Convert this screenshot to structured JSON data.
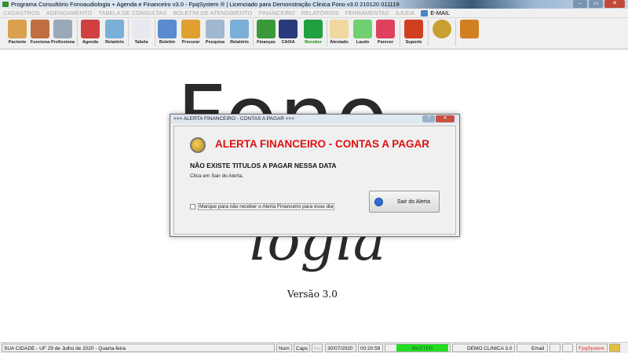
{
  "window": {
    "title": "Programa Consultório Fonoaudiologia + Agenda e Financeiro v3.0 - FpqSystem ® | Licenciado para  Demonstração Clinica Fono v3.0 210120 011119",
    "min": "–",
    "max": "▭",
    "close": "✕"
  },
  "menu": [
    "CADASTROS",
    "AGENDAMENTO",
    "TABELA DE CONSULTAS",
    "BOLETIM DE ATENDIMENTO",
    "FINANCEIRO",
    "RELATÓRIOS",
    "FERRAMENTAS",
    "AJUDA"
  ],
  "menu_email": "E-MAIL",
  "toolbar": [
    {
      "label": "Paciente",
      "icon": "patients-icon",
      "color": "#d9a050"
    },
    {
      "label": "Funciona",
      "icon": "employees-icon",
      "color": "#c07040"
    },
    {
      "label": "Profissiona",
      "icon": "doctor-icon",
      "color": "#9aa8b8"
    },
    {
      "label": "Agenda",
      "icon": "calendar-icon",
      "color": "#d04040"
    },
    {
      "label": "Relatório",
      "icon": "printer-icon",
      "color": "#7ab0d8"
    },
    {
      "label": "Tabela",
      "icon": "document-icon",
      "color": "#e8e8f0"
    },
    {
      "label": "Boletim",
      "icon": "bulletin-icon",
      "color": "#5a8ad0"
    },
    {
      "label": "Procurar",
      "icon": "folder-icon",
      "color": "#e0a030"
    },
    {
      "label": "Pesquisa",
      "icon": "search-icon",
      "color": "#a0b8d0"
    },
    {
      "label": "Relatório",
      "icon": "printer-icon",
      "color": "#7ab0d8"
    },
    {
      "label": "Finanças",
      "icon": "finance-chart-icon",
      "color": "#3a9a3a"
    },
    {
      "label": "CAIXA",
      "icon": "cash-book-icon",
      "color": "#2a3a7a"
    },
    {
      "label": "Receber",
      "icon": "money-icon",
      "color": "#20a040"
    },
    {
      "label": "Atestado",
      "icon": "certificate-icon",
      "color": "#f0d8a0"
    },
    {
      "label": "Laudo",
      "icon": "report-icon",
      "color": "#70d070"
    },
    {
      "label": "Parecer",
      "icon": "opinion-icon",
      "color": "#e04060"
    },
    {
      "label": "Suporte",
      "icon": "support-icon",
      "color": "#d04020"
    },
    {
      "label": "",
      "icon": "coin-icon",
      "color": "#c8a030"
    },
    {
      "label": "",
      "icon": "exit-door-icon",
      "color": "#d08020"
    }
  ],
  "background": {
    "logo_top": "Fono",
    "logo_bottom": "logia",
    "version": "Versão 3.0"
  },
  "dialog": {
    "title": ">>> ALERTA FINANCEIRO - CONTAS A PAGAR <<<",
    "help": "?",
    "close": "✕",
    "heading": "ALERTA FINANCEIRO - CONTAS A PAGAR",
    "message": "NÃO EXISTE TITULOS A PAGAR NESSA DATA",
    "instruction": "Clica em Sair do Alerta.",
    "checkbox_label": "Marque para não receber o Alerta Financeiro para esse dia",
    "checkbox_checked": false,
    "exit_button": "Sair do Alerta",
    "heading_color": "#e01010"
  },
  "status": {
    "location": "SUA CIDADE - UF 29 de Julho de 2020 - Quarta-feira",
    "num": "Num",
    "caps": "Caps",
    "ins": "Ins",
    "date": "30/07/2020",
    "time": "00:20:59",
    "user": "MASTER",
    "user_color": "#22dd22",
    "clinic": "DEMO CLINICA 3.0",
    "email": "Email",
    "brand": "FpqSystem"
  }
}
